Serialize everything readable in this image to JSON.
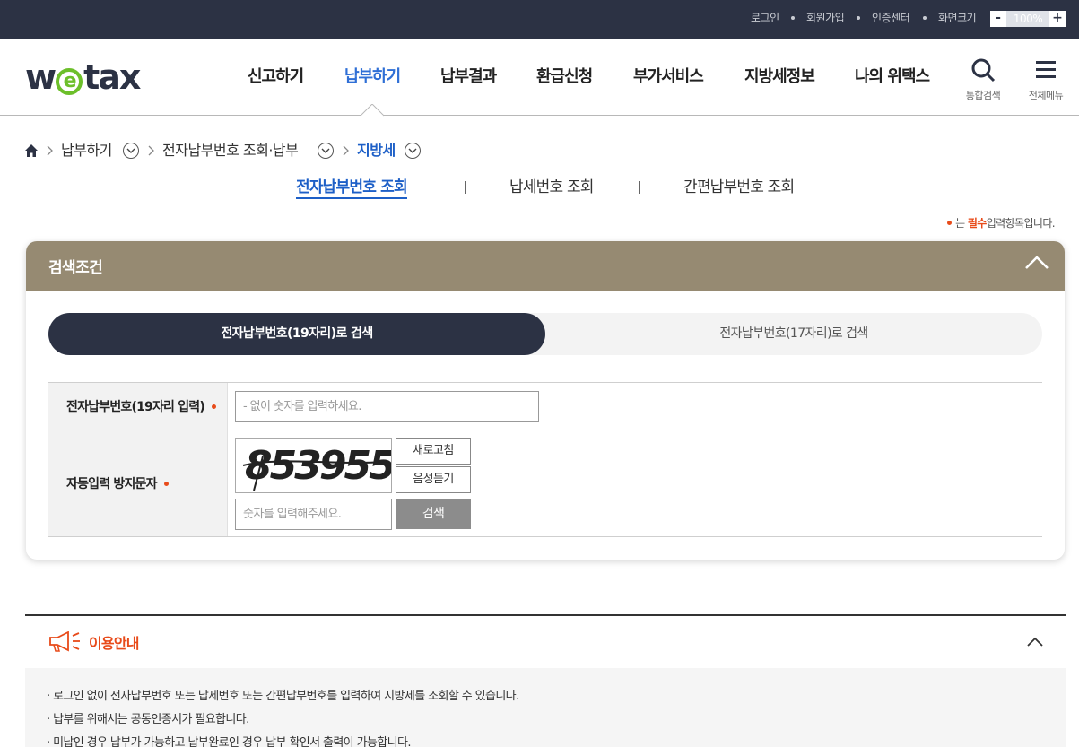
{
  "utility": {
    "login": "로그인",
    "signup": "회원가입",
    "cert_center": "인증센터",
    "screen_size": "화면크기",
    "zoom_minus": "-",
    "zoom_value": "100%",
    "zoom_plus": "+"
  },
  "header": {
    "logo": {
      "pre": "w",
      "mid": "e",
      "post": "tax"
    },
    "nav": [
      "신고하기",
      "납부하기",
      "납부결과",
      "환급신청",
      "부가서비스",
      "지방세정보",
      "나의 위택스"
    ],
    "active_nav": "납부하기",
    "search_label": "통합검색",
    "menu_label": "전체메뉴"
  },
  "breadcrumb": {
    "home_icon": "home-icon",
    "level1": "납부하기",
    "level2": "전자납부번호 조회·납부",
    "level3": "지방세"
  },
  "subtabs": [
    "전자납부번호 조회",
    "납세번호 조회",
    "간편납부번호 조회"
  ],
  "required_note": {
    "pre": "는",
    "bold": "필수",
    "post": "입력항목입니다."
  },
  "search_box": {
    "title": "검색조건",
    "seg_active": "전자납부번호(19자리)로 검색",
    "seg_inactive": "전자납부번호(17자리)로 검색",
    "field1_label": "전자납부번호(19자리 입력)",
    "field1_placeholder": "- 없이 숫자를 입력하세요.",
    "field2_label": "자동입력 방지문자",
    "captcha_text": "853955",
    "refresh_label": "새로고침",
    "audio_label": "음성듣기",
    "captcha_placeholder": "숫자를 입력해주세요.",
    "search_label": "검색"
  },
  "guide": {
    "title": "이용안내",
    "items": [
      "· 로그인 없이 전자납부번호 또는 납세번호 또는 간편납부번호를 입력하여 지방세를 조회할 수 있습니다.",
      "· 납부를 위해서는 공동인증서가 필요합니다.",
      "· 미납인 경우 납부가 가능하고 납부완료인 경우 납부 확인서 출력이 가능합니다."
    ]
  },
  "colors": {
    "topbar": "#2c3244",
    "accent_blue": "#1d5fc7",
    "nav_active": "#2f6fd6",
    "search_head": "#968a72",
    "required": "#e84b1a",
    "logo_green": "#6cbf2a"
  }
}
